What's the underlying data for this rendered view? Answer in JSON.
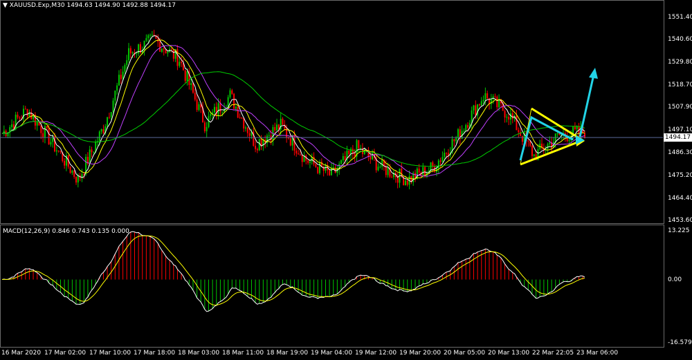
{
  "header": {
    "symbol_info": "XAUUSD.Exp,M30  1494.63 1494.90 1492.88 1494.17",
    "menu_glyph": "▼"
  },
  "current_price": "1494.17",
  "price_ticks": [
    "1551.40",
    "1540.60",
    "1529.80",
    "1518.70",
    "1507.90",
    "1497.10",
    "1486.30",
    "1475.20",
    "1464.40",
    "1453.60"
  ],
  "macd": {
    "label": "MACD(12,26,9) 0.846 0.743 0.135 0.000",
    "ticks": [
      "13.225",
      "0.00",
      "-16.579"
    ]
  },
  "time_ticks": [
    "16 Mar 2020",
    "17 Mar 02:00",
    "17 Mar 10:00",
    "17 Mar 18:00",
    "18 Mar 03:00",
    "18 Mar 11:00",
    "18 Mar 19:00",
    "19 Mar 04:00",
    "19 Mar 12:00",
    "19 Mar 20:00",
    "20 Mar 05:00",
    "20 Mar 13:00",
    "22 Mar 22:05",
    "23 Mar 06:00"
  ],
  "colors": {
    "bull": "#00c800",
    "bear": "#ff0000",
    "ma_fast": "#ffffff",
    "ma_mid": "#ffff00",
    "ma_slow": "#c040ff",
    "ma_long": "#00cc00",
    "triangle": "#ffff00",
    "arrow": "#22d3e6",
    "hline": "#5a6a9a"
  },
  "chart_data": {
    "type": "candlestick",
    "ylim": [
      1450,
      1557
    ],
    "key_closes": [
      1493,
      1505,
      1488,
      1470,
      1496,
      1533,
      1540,
      1530,
      1498,
      1512,
      1488,
      1497,
      1480,
      1472,
      1486,
      1476,
      1470,
      1476,
      1492,
      1512,
      1503,
      1482,
      1492,
      1494
    ],
    "macd_ylim": [
      -16.579,
      13.225
    ]
  }
}
